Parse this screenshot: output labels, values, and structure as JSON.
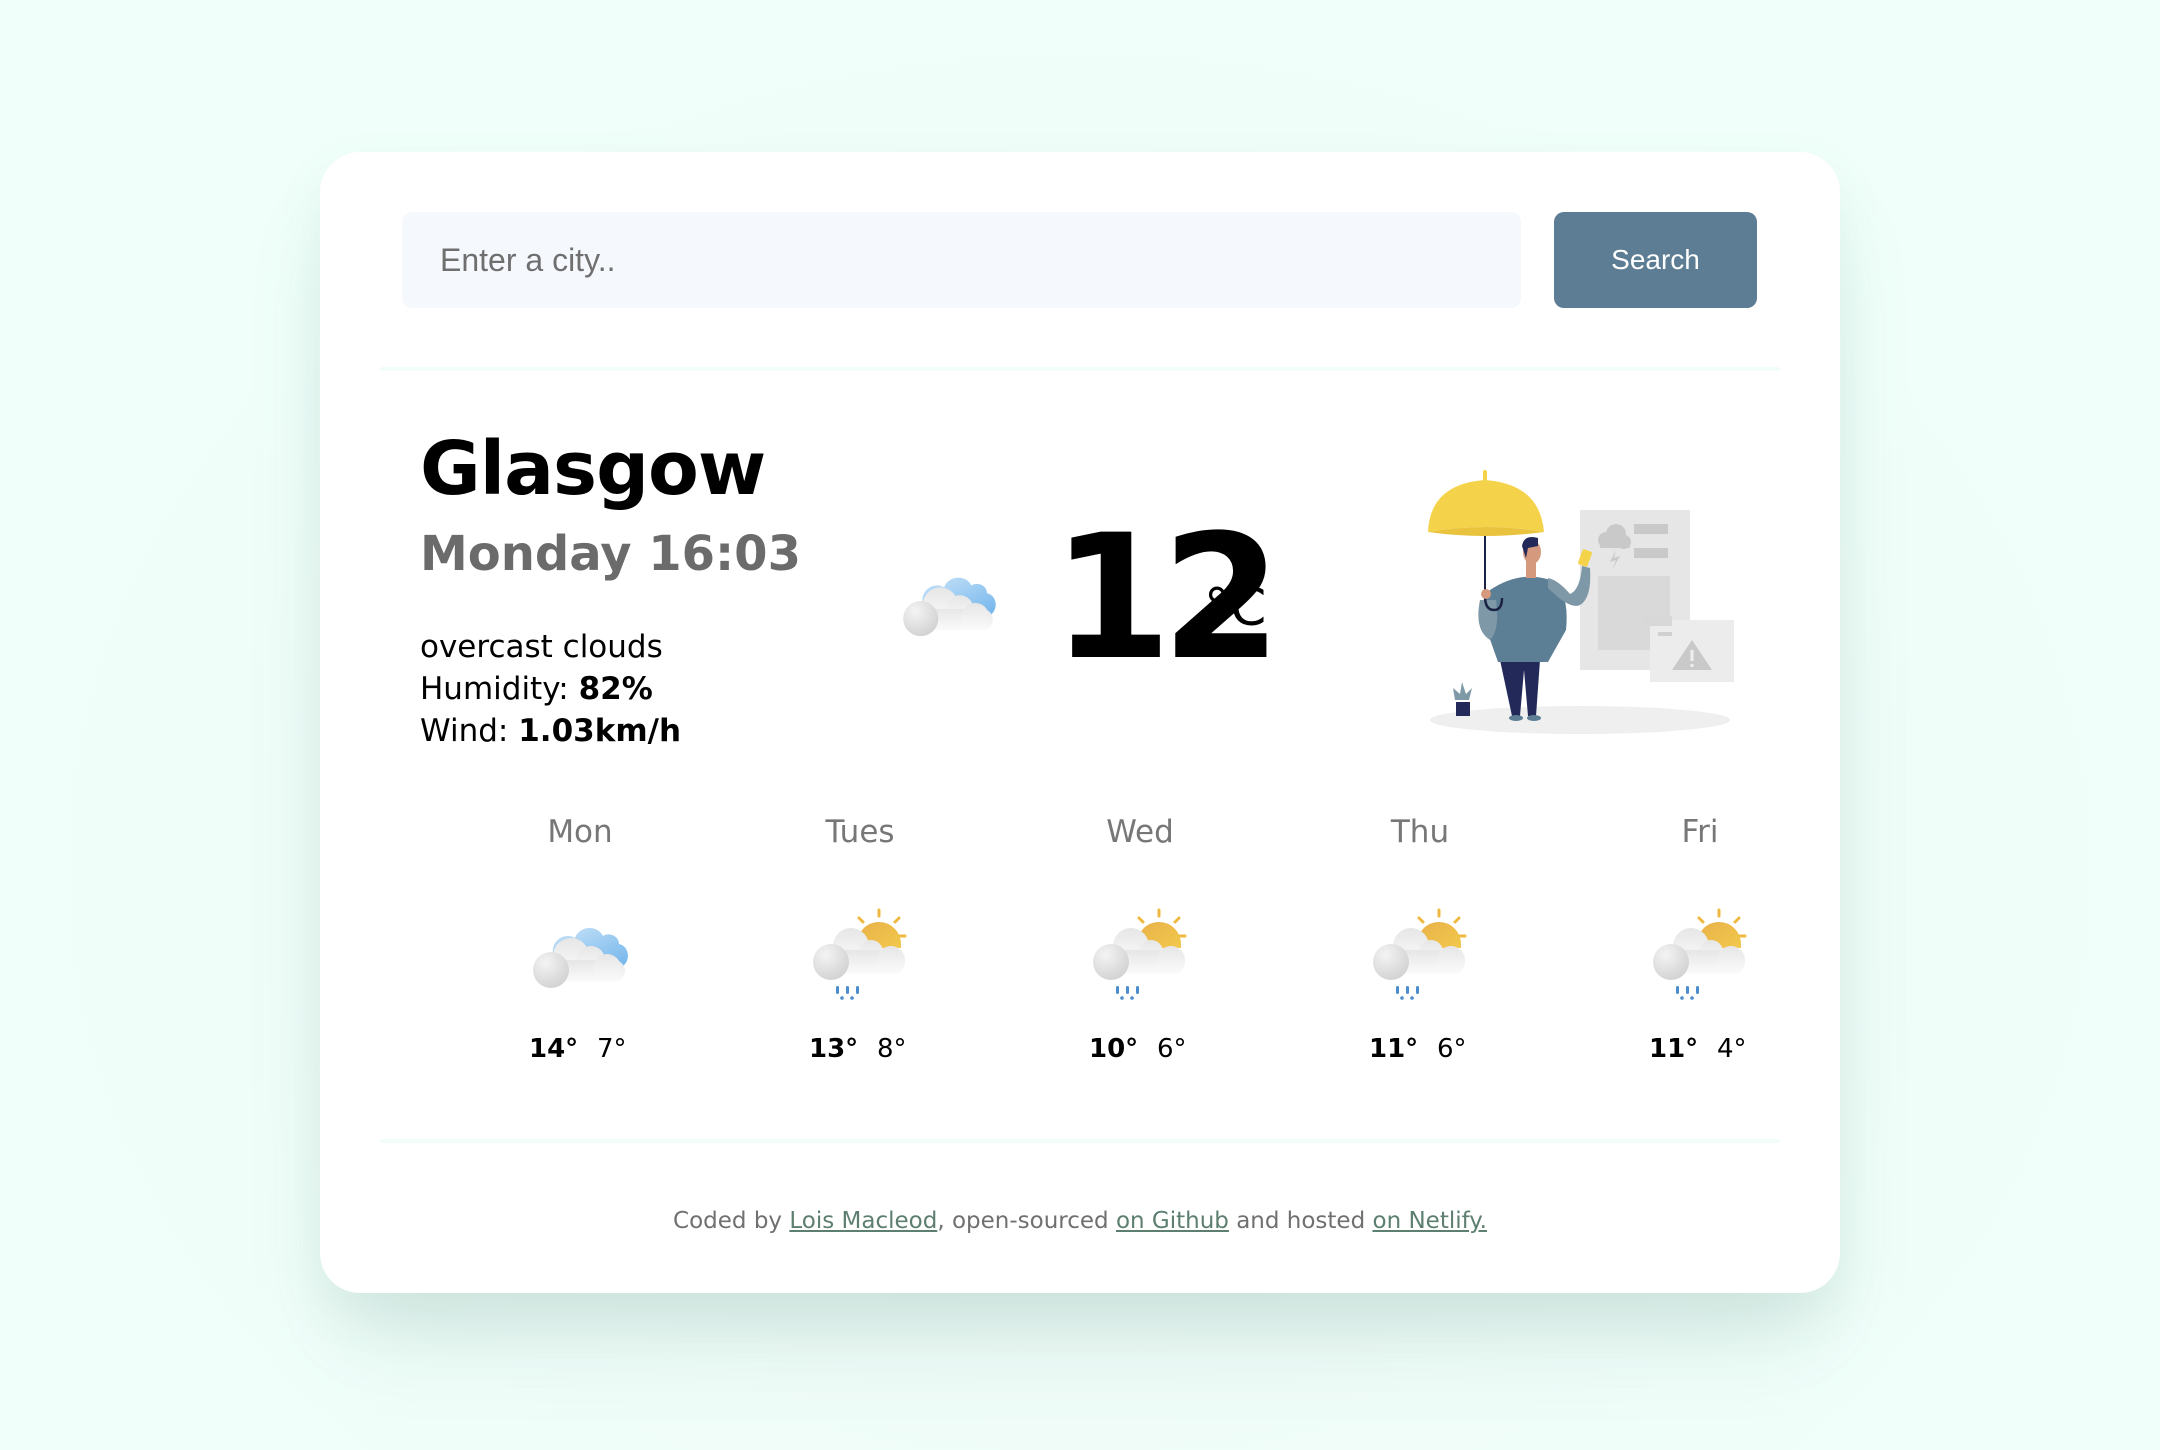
{
  "search": {
    "placeholder": "Enter a city..",
    "value": "",
    "button_label": "Search"
  },
  "current": {
    "city": "Glasgow",
    "date_time": "Monday 16:03",
    "description": "overcast clouds",
    "humidity_label": "Humidity: ",
    "humidity_value": "82%",
    "wind_label": "Wind: ",
    "wind_value": "1.03km/h",
    "temperature": "12",
    "unit": "°C",
    "icon": "overcast-clouds-icon"
  },
  "forecast": [
    {
      "day": "Mon",
      "max": "14°",
      "min": "7°",
      "icon": "overcast-clouds-icon"
    },
    {
      "day": "Tues",
      "max": "13°",
      "min": "8°",
      "icon": "sun-cloud-rain-icon"
    },
    {
      "day": "Wed",
      "max": "10°",
      "min": "6°",
      "icon": "sun-cloud-rain-icon"
    },
    {
      "day": "Thu",
      "max": "11°",
      "min": "6°",
      "icon": "sun-cloud-rain-icon"
    },
    {
      "day": "Fri",
      "max": "11°",
      "min": "4°",
      "icon": "sun-cloud-rain-icon"
    }
  ],
  "footer": {
    "prefix": "Coded by ",
    "author_link": "Lois Macleod",
    "middle": ", open-sourced ",
    "github_link": "on Github",
    "and_hosted": " and hosted ",
    "netlify_link": "on Netlify."
  },
  "colors": {
    "accent": "#5c7d93",
    "background": "#f0fffa",
    "link": "#5d7f6f",
    "input_bg": "#f5f8fc"
  }
}
